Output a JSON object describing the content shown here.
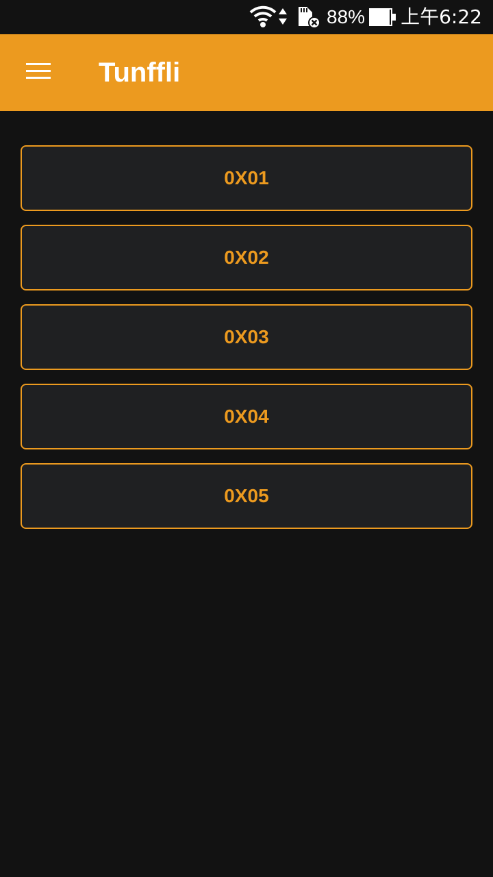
{
  "status_bar": {
    "battery_percent": "88%",
    "time": "上午6:22",
    "icons": [
      "wifi-icon",
      "data-arrows-icon",
      "sd-card-error-icon",
      "battery-icon"
    ]
  },
  "app_bar": {
    "title": "Tunffli",
    "menu_icon": "hamburger-menu-icon"
  },
  "buttons": [
    {
      "label": "0X01"
    },
    {
      "label": "0X02"
    },
    {
      "label": "0X03"
    },
    {
      "label": "0X04"
    },
    {
      "label": "0X05"
    }
  ],
  "colors": {
    "accent": "#EC9A1F",
    "background": "#121212",
    "button_background": "#1F2022",
    "text_on_accent": "#FFFFFF"
  }
}
